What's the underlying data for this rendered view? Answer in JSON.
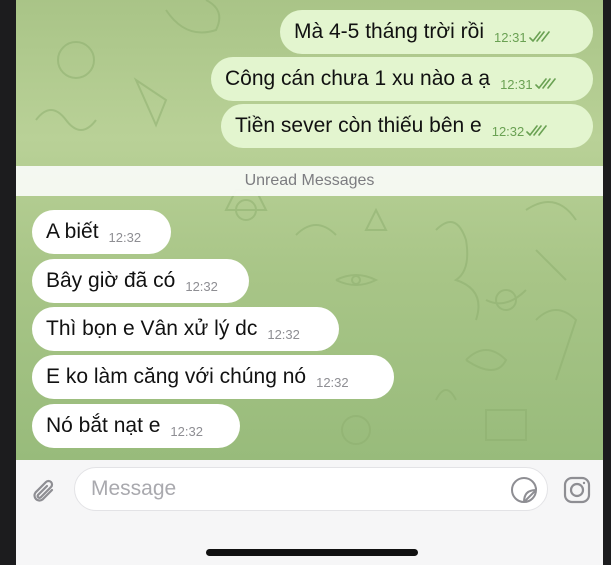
{
  "messages_before_unread": [
    {
      "text": "Mà 4-5 tháng trời rồi",
      "time": "12:31",
      "direction": "outgoing",
      "status": "read"
    },
    {
      "text": "Công cán chưa 1 xu nào a ạ",
      "time": "12:31",
      "direction": "outgoing",
      "status": "read"
    },
    {
      "text": "Tiền sever còn thiếu bên e",
      "time": "12:32",
      "direction": "outgoing",
      "status": "read"
    }
  ],
  "unread_divider": "Unread Messages",
  "messages_after_unread": [
    {
      "text": "A biết",
      "time": "12:32",
      "direction": "incoming"
    },
    {
      "text": "Bây giờ đã có",
      "time": "12:32",
      "direction": "incoming"
    },
    {
      "text": "Thì bọn e Vân xử lý dc",
      "time": "12:32",
      "direction": "incoming"
    },
    {
      "text": "E ko làm căng với chúng nó",
      "time": "12:32",
      "direction": "incoming"
    },
    {
      "text": "Nó bắt nạt e",
      "time": "12:32",
      "direction": "incoming"
    }
  ],
  "composer": {
    "placeholder": "Message",
    "attach_icon": "paperclip-icon",
    "sticker_icon": "sticker-icon",
    "camera_icon": "camera-icon"
  },
  "colors": {
    "outgoing_bubble": "#e3f5cf",
    "incoming_bubble": "#ffffff",
    "read_check": "#6aa153",
    "chat_wallpaper": "#b4cd92"
  }
}
